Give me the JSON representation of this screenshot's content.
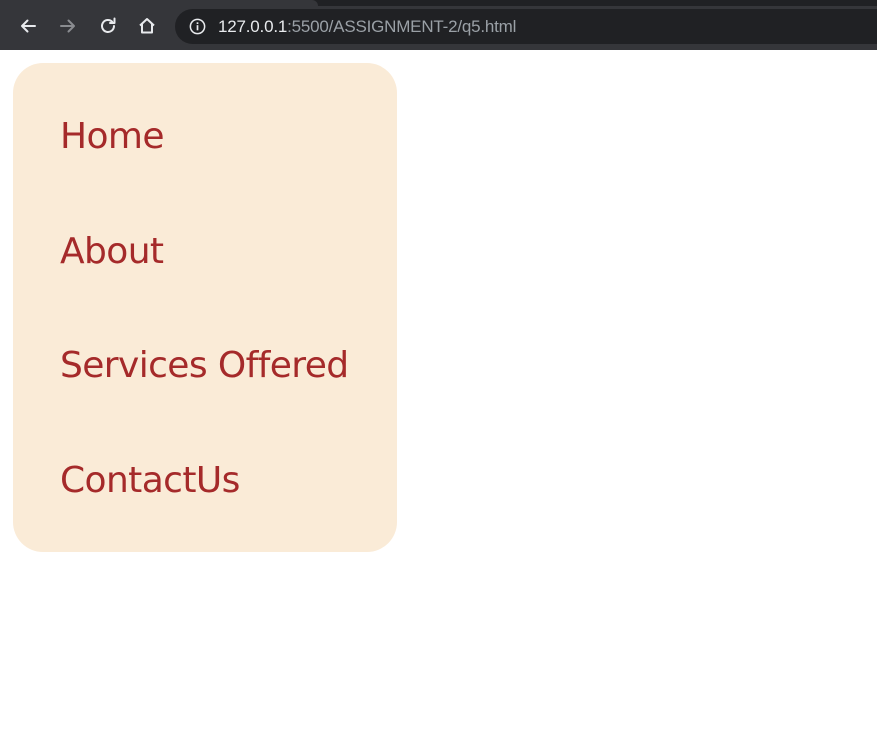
{
  "browser": {
    "url_host": "127.0.0.1",
    "url_rest": ":5500/ASSIGNMENT-2/q5.html",
    "icons": {
      "back": "back-arrow-icon",
      "forward": "forward-arrow-icon",
      "reload": "reload-icon",
      "home": "home-icon",
      "site_info": "info-circle-icon"
    },
    "colors": {
      "toolbar": "#35363a",
      "omnibox": "#202124",
      "host_text": "#e8eaed",
      "path_text": "#9aa0a6"
    }
  },
  "nav": {
    "items": [
      {
        "label": "Home"
      },
      {
        "label": "About"
      },
      {
        "label": "Services Offered"
      },
      {
        "label": "ContactUs"
      }
    ],
    "colors": {
      "background": "#faebd7",
      "link": "#a52a2a"
    }
  }
}
